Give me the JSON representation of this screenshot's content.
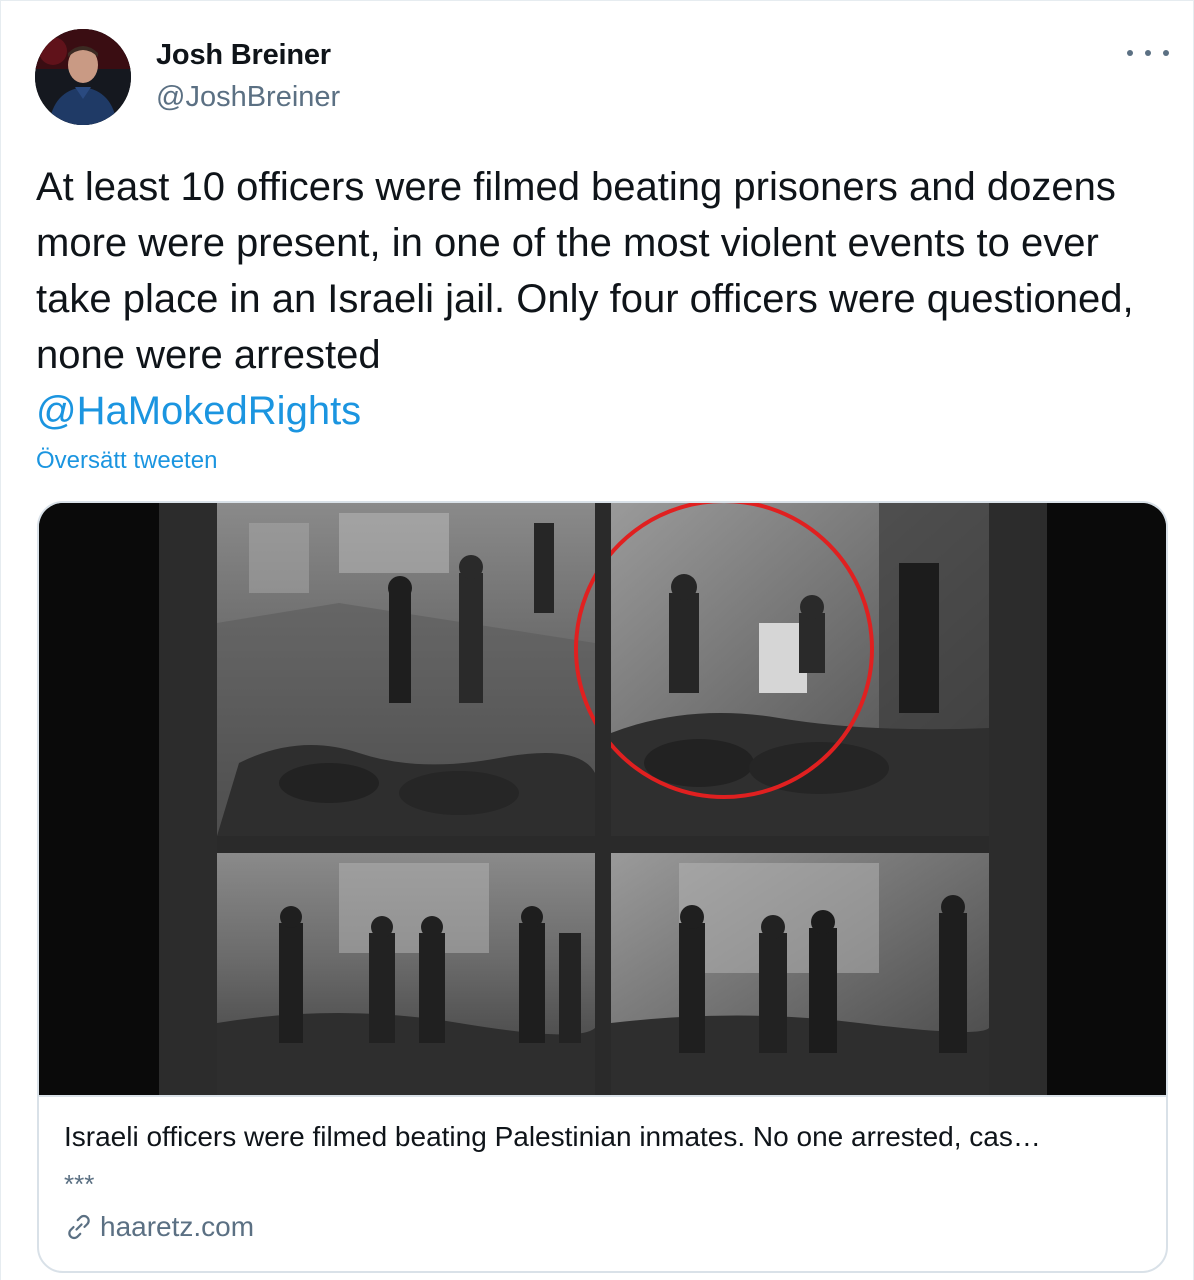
{
  "author": {
    "name": "Josh Breiner",
    "handle": "@JoshBreiner",
    "avatar_icon": "profile-photo"
  },
  "more_icon": "ellipsis-icon",
  "tweet": {
    "text": "At least 10 officers were filmed beating prisoners and dozens more were present, in one of the most violent events to ever take place in an Israeli jail. Only four officers were questioned, none were arrested",
    "mention": "@HaMokedRights",
    "translate_label": "Översätt tweeten"
  },
  "card": {
    "title": "Israeli officers were filmed beating Palestinian inmates. No one arrested, cas…",
    "description": "***",
    "domain": "haaretz.com",
    "domain_icon": "link-icon",
    "image": "surveillance-footage-collage"
  },
  "colors": {
    "link": "#1b95e0",
    "secondary_text": "#5b7083",
    "primary_text": "#0f1419",
    "border": "#d9e1e8",
    "highlight_circle": "#e02020"
  }
}
